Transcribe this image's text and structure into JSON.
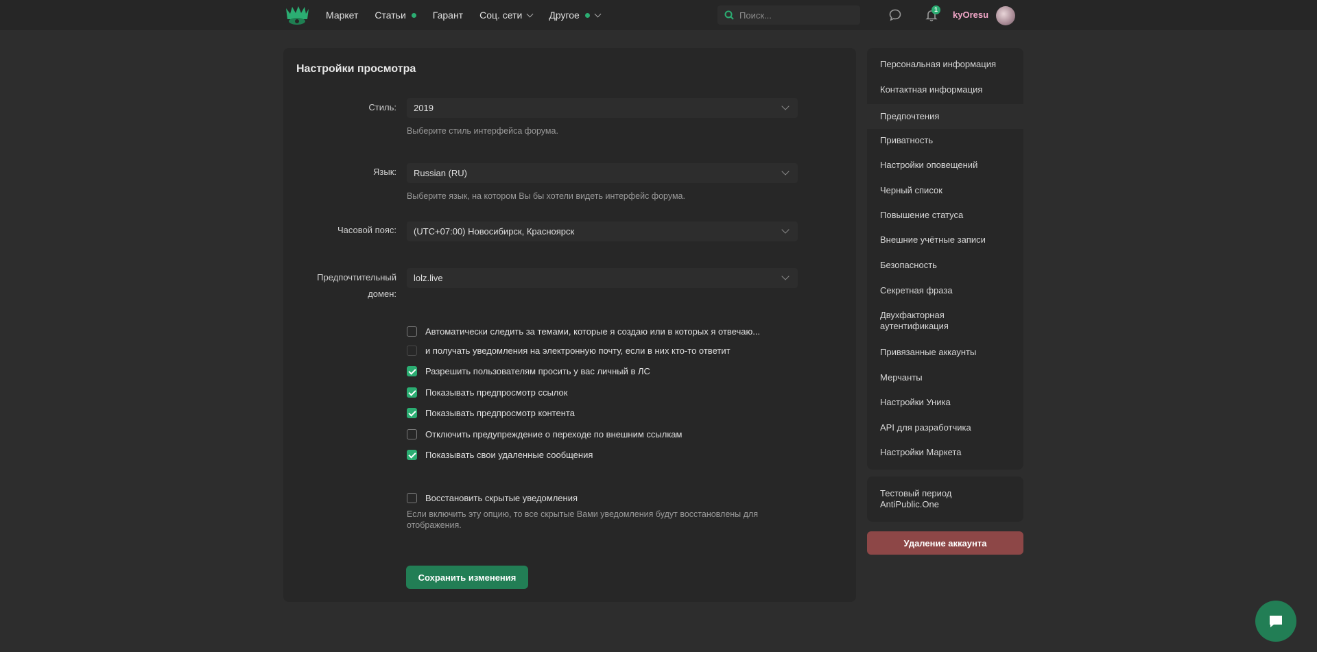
{
  "header": {
    "nav": [
      {
        "label": "Маркет",
        "dot": false,
        "chevron": false
      },
      {
        "label": "Статьи",
        "dot": true,
        "chevron": false
      },
      {
        "label": "Гарант",
        "dot": false,
        "chevron": false
      },
      {
        "label": "Соц. сети",
        "dot": false,
        "chevron": true
      },
      {
        "label": "Другое",
        "dot": true,
        "chevron": true
      }
    ],
    "search_placeholder": "Поиск...",
    "notifications_count": "1",
    "username": "kyOresu"
  },
  "settings": {
    "title": "Настройки просмотра",
    "style_label": "Стиль:",
    "style_value": "2019",
    "style_hint": "Выберите стиль интерфейса форума.",
    "language_label": "Язык:",
    "language_value": "Russian (RU)",
    "language_hint": "Выберите язык, на котором Вы бы хотели видеть интерфейс форума.",
    "timezone_label": "Часовой пояс:",
    "timezone_value": "(UTC+07:00) Новосибирск, Красноярск",
    "domain_label_line1": "Предпочтительный",
    "domain_label_line2": "домен:",
    "domain_value": "lolz.live",
    "options": [
      {
        "label": "Автоматически следить за темами, которые я создаю или в которых я отвечаю...",
        "checked": false,
        "disabled": false
      },
      {
        "label": "и получать уведомления на электронную почту, если в них кто-то ответит",
        "checked": false,
        "disabled": true
      },
      {
        "label": "Разрешить пользователям просить у вас личный в ЛС",
        "checked": true,
        "disabled": false
      },
      {
        "label": "Показывать предпросмотр ссылок",
        "checked": true,
        "disabled": false
      },
      {
        "label": "Показывать предпросмотр контента",
        "checked": true,
        "disabled": false
      },
      {
        "label": "Отключить предупреждение о переходе по внешним ссылкам",
        "checked": false,
        "disabled": false
      },
      {
        "label": "Показывать свои удаленные сообщения",
        "checked": true,
        "disabled": false
      }
    ],
    "restore_label": "Восстановить скрытые уведомления",
    "restore_hint": "Если включить эту опцию, то все скрытые Вами уведомления будут восстановлены для отображения.",
    "save_label": "Сохранить изменения"
  },
  "sidebar": {
    "items": [
      {
        "label": "Персональная информация"
      },
      {
        "label": "Контактная информация"
      },
      {
        "label": "Предпочтения"
      },
      {
        "label": "Приватность"
      },
      {
        "label": "Настройки оповещений"
      },
      {
        "label": "Черный список"
      },
      {
        "label": "Повышение статуса"
      },
      {
        "label": "Внешние учётные записи"
      },
      {
        "label": "Безопасность"
      },
      {
        "label": "Секретная фраза"
      },
      {
        "label": "Двухфакторная аутентификация"
      },
      {
        "label": "Привязанные аккаунты"
      },
      {
        "label": "Мерчанты"
      },
      {
        "label": "Настройки Уника"
      },
      {
        "label": "API для разработчика"
      },
      {
        "label": "Настройки Маркета"
      }
    ],
    "active_index": 2,
    "trial_text": "Тестовый период AntiPublic.One",
    "delete_label": "Удаление аккаунта"
  },
  "colors": {
    "accent": "#2bad72",
    "danger": "#8d4747",
    "background": "#2d2d2d",
    "panel": "#272727"
  }
}
